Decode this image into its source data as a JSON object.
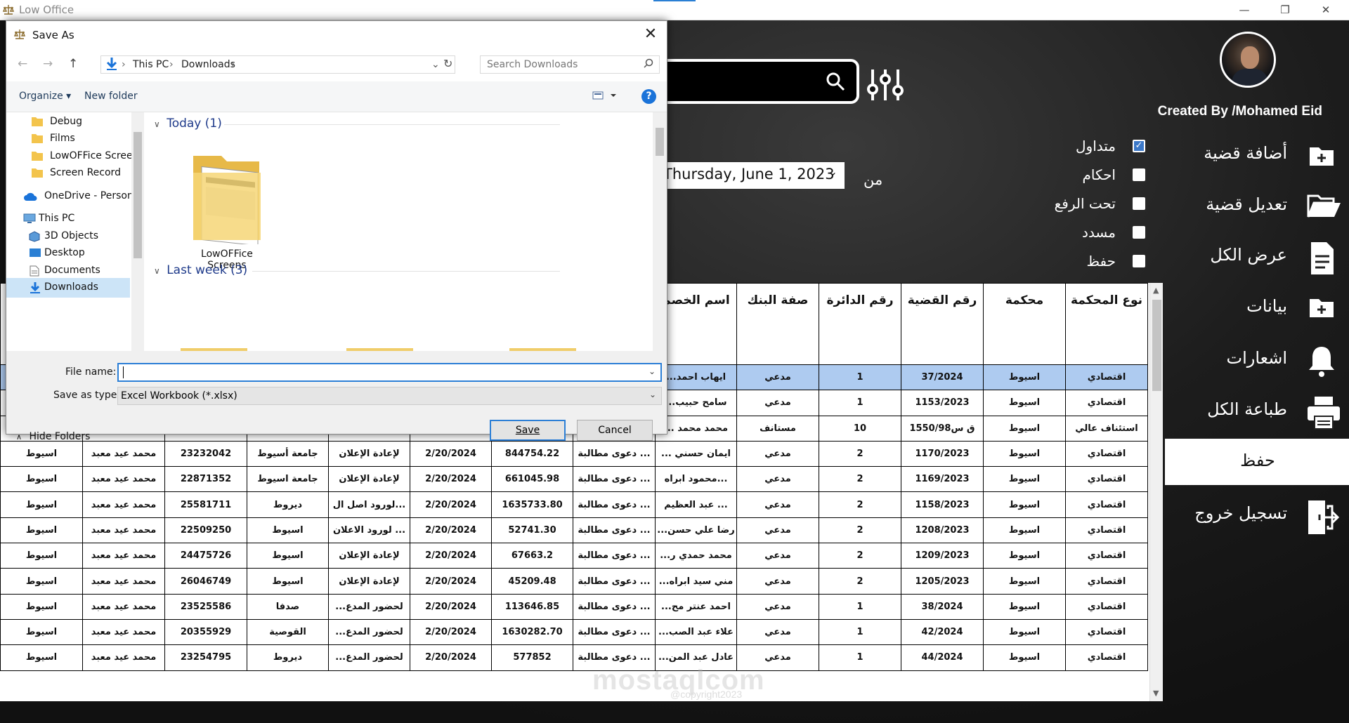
{
  "window": {
    "title": "Low Office",
    "minimize": "—",
    "maximize": "❐",
    "close": "✕"
  },
  "sidebar": {
    "created_by": "Created By /Mohamed Eid",
    "items": [
      {
        "label": "أضافة قضية",
        "icon": "add-file-icon"
      },
      {
        "label": "تعديل قضية",
        "icon": "folder-open-icon"
      },
      {
        "label": "عرض الكل",
        "icon": "document-icon"
      },
      {
        "label": "بيانات",
        "icon": "add-file-icon"
      },
      {
        "label": "اشعارات",
        "icon": "bell-icon"
      },
      {
        "label": "طباعة الكل",
        "icon": "printer-icon"
      },
      {
        "label": "حفظ",
        "icon": ""
      },
      {
        "label": "تسجيل خروج",
        "icon": "logout-icon"
      }
    ]
  },
  "filters": {
    "statuses": [
      {
        "label": "متداول",
        "checked": true
      },
      {
        "label": "احكام",
        "checked": false
      },
      {
        "label": "تحت الرفع",
        "checked": false
      },
      {
        "label": "مسدد",
        "checked": false
      },
      {
        "label": "حفظ",
        "checked": false
      }
    ],
    "date_value": "Thursday, June 1, 2023",
    "from_label": "من"
  },
  "table": {
    "headers": [
      "",
      "",
      "",
      "",
      "",
      "",
      "",
      "اسم الخصم",
      "صفة البنك",
      "رقم الدائرة",
      "رقم القضية",
      "محكمة",
      "نوع المحكمة"
    ],
    "rows": [
      [
        "",
        "",
        "",
        "",
        "",
        "",
        "",
        "...ايهاب احمد",
        "مدعي",
        "1",
        "37/2024",
        "اسيوط",
        "اقتصادي"
      ],
      [
        "",
        "",
        "",
        "",
        "",
        "",
        "",
        "...سامح حبيب",
        "مدعي",
        "1",
        "1153/2023",
        "اسيوط",
        "اقتصادي"
      ],
      [
        "",
        "",
        "",
        "",
        "",
        "",
        "",
        "... محمد محمد",
        "مستانف",
        "10",
        "1550/98ق س",
        "اسيوط",
        "استئناف عالي"
      ],
      [
        "اسيوط",
        "محمد عيد معبد",
        "23232042",
        "جامعة أسيوط",
        "لإعادة الإعلان",
        "2/20/2024",
        "844754.22",
        "دعوى مطالبة ...",
        "... ايمان حسني",
        "مدعي",
        "2",
        "1170/2023",
        "اسيوط",
        "اقتصادي"
      ],
      [
        "اسيوط",
        "محمد عيد معبد",
        "22871352",
        "جامعة اسيوط",
        "لإعادة الإعلان",
        "2/20/2024",
        "661045.98",
        "دعوى مطالبة ...",
        "محمود ابراه...",
        "مدعي",
        "2",
        "1169/2023",
        "اسيوط",
        "اقتصادي"
      ],
      [
        "اسيوط",
        "محمد عيد معبد",
        "25581711",
        "ديروط",
        "لورود اصل ال...",
        "2/20/2024",
        "1635733.80",
        "دعوى مطالبة ...",
        "عبد العظيم ...",
        "مدعي",
        "2",
        "1158/2023",
        "اسيوط",
        "اقتصادي"
      ],
      [
        "اسيوط",
        "محمد عيد معبد",
        "22509250",
        "اسيوط",
        "لورود الاعلان ...",
        "2/20/2024",
        "52741.30",
        "دعوى مطالبة ...",
        "...رضا علي حسن",
        "مدعي",
        "2",
        "1208/2023",
        "اسيوط",
        "اقتصادي"
      ],
      [
        "اسيوط",
        "محمد عيد معبد",
        "24475726",
        "اسيوط",
        "لإعادة الإعلان",
        "2/20/2024",
        "67663.2",
        "دعوى مطالبة ...",
        "...محمد حمدي ر",
        "مدعي",
        "2",
        "1209/2023",
        "اسيوط",
        "اقتصادي"
      ],
      [
        "اسيوط",
        "محمد عيد معبد",
        "26046749",
        "اسيوط",
        "لإعادة الإعلان",
        "2/20/2024",
        "45209.48",
        "دعوى مطالبة ...",
        "...مني سيد ابراه",
        "مدعي",
        "2",
        "1205/2023",
        "اسيوط",
        "اقتصادي"
      ],
      [
        "اسيوط",
        "محمد عيد معبد",
        "23525586",
        "صدفا",
        "...لحضور المدع",
        "2/20/2024",
        "113646.85",
        "دعوى مطالبة ...",
        "...احمد عنتر مح",
        "مدعي",
        "1",
        "38/2024",
        "اسيوط",
        "اقتصادي"
      ],
      [
        "اسيوط",
        "محمد عيد معبد",
        "20355929",
        "القوصية",
        "...لحضور المدع",
        "2/20/2024",
        "1630282.70",
        "دعوى مطالبة ...",
        "...علاء عبد الصب",
        "مدعي",
        "1",
        "42/2024",
        "اسيوط",
        "اقتصادي"
      ],
      [
        "اسيوط",
        "محمد عيد معبد",
        "23254795",
        "ديروط",
        "...لحضور المدع",
        "2/20/2024",
        "577852",
        "دعوى مطالبة ...",
        "...عادل عبد المن",
        "مدعي",
        "1",
        "44/2024",
        "اسيوط",
        "اقتصادي"
      ]
    ]
  },
  "footer": {
    "copyright": "@copyright2023",
    "watermark": "mostaqlcom"
  },
  "dialog": {
    "title": "Save As",
    "close": "✕",
    "breadcrumb": [
      "This PC",
      "Downloads"
    ],
    "search_placeholder": "Search Downloads",
    "toolbar": {
      "organize": "Organize ▾",
      "new_folder": "New folder",
      "help": "?"
    },
    "nav_items": [
      {
        "label": "Debug",
        "icon": "folder-icon"
      },
      {
        "label": "Films",
        "icon": "folder-icon"
      },
      {
        "label": "LowOFFice Screens",
        "icon": "folder-icon"
      },
      {
        "label": "Screen Record",
        "icon": "folder-icon"
      },
      {
        "label": "OneDrive - Personal",
        "icon": "cloud-icon"
      },
      {
        "label": "This PC",
        "icon": "pc-icon"
      },
      {
        "label": "3D Objects",
        "icon": "cube-icon"
      },
      {
        "label": "Desktop",
        "icon": "desktop-icon"
      },
      {
        "label": "Documents",
        "icon": "documents-icon"
      },
      {
        "label": "Downloads",
        "icon": "download-arrow-icon"
      }
    ],
    "groups": [
      {
        "label": "Today (1)"
      },
      {
        "label": "Last week (3)"
      }
    ],
    "folder_tile": "LowOFFice Screens",
    "file_name_label": "File name:",
    "file_name_value": "",
    "save_type_label": "Save as type:",
    "save_type_value": "Excel Workbook (*.xlsx)",
    "save_label": "Save",
    "cancel_label": "Cancel",
    "hide_folders": "Hide Folders"
  },
  "colors": {
    "accent": "#2c7fd6",
    "selected_row": "#aecbf0",
    "sidebar_active": "#ffffff"
  }
}
